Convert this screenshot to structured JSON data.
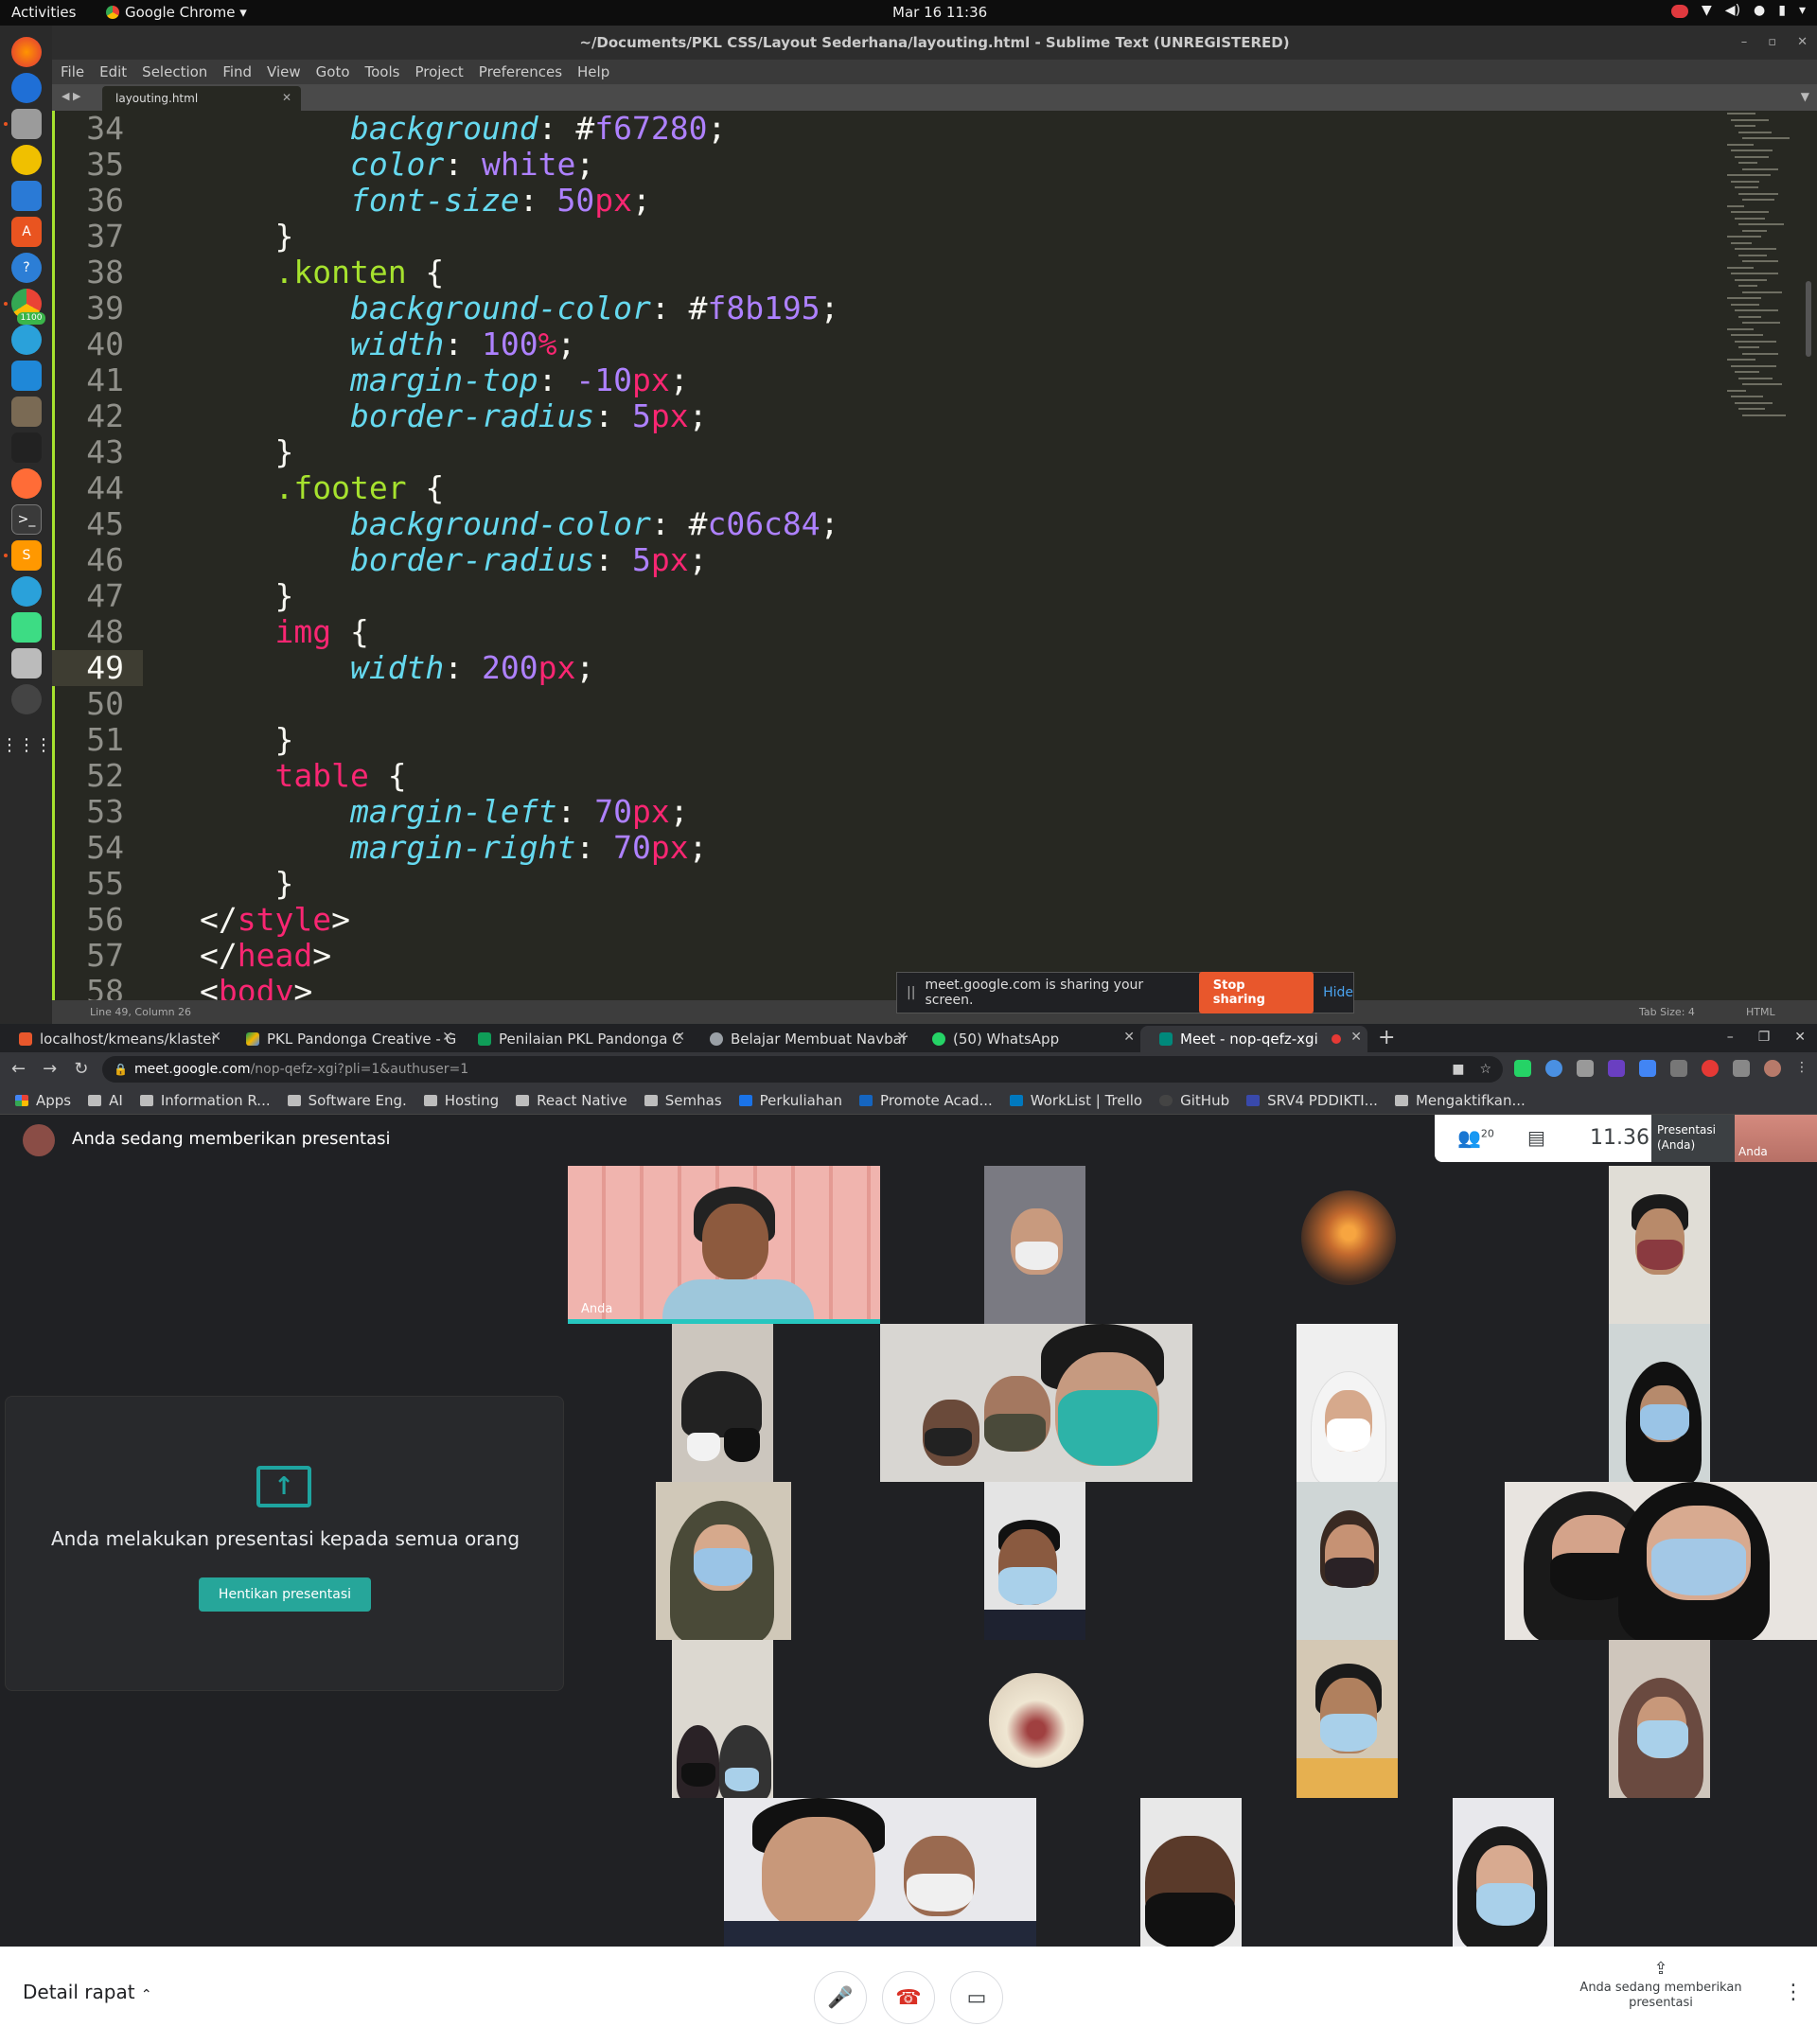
{
  "ubuntu": {
    "activities": "Activities",
    "app_menu": "Google Chrome ▾",
    "clock": "Mar 16  11:36"
  },
  "sublime": {
    "title": "~/Documents/PKL CSS/Layout Sederhana/layouting.html - Sublime Text (UNREGISTERED)",
    "menu": [
      "File",
      "Edit",
      "Selection",
      "Find",
      "View",
      "Goto",
      "Tools",
      "Project",
      "Preferences",
      "Help"
    ],
    "tab": "layouting.html",
    "status_position": "Line 49, Column 26",
    "tab_size": "Tab Size: 4",
    "syntax": "HTML",
    "current_line": 49,
    "lines": [
      {
        "n": "34",
        "parts": [
          [
            "pl",
            "        "
          ],
          [
            "prop",
            "background"
          ],
          [
            "pl",
            ": #"
          ],
          [
            "num",
            "f67280"
          ],
          [
            "pl",
            ";"
          ]
        ]
      },
      {
        "n": "35",
        "parts": [
          [
            "pl",
            "        "
          ],
          [
            "prop",
            "color"
          ],
          [
            "pl",
            ": "
          ],
          [
            "num",
            "white"
          ],
          [
            "pl",
            ";"
          ]
        ]
      },
      {
        "n": "36",
        "parts": [
          [
            "pl",
            "        "
          ],
          [
            "prop",
            "font-size"
          ],
          [
            "pl",
            ": "
          ],
          [
            "num",
            "50"
          ],
          [
            "unit",
            "px"
          ],
          [
            "pl",
            ";"
          ]
        ]
      },
      {
        "n": "37",
        "parts": [
          [
            "pl",
            "    }"
          ]
        ]
      },
      {
        "n": "38",
        "parts": [
          [
            "pl",
            "    "
          ],
          [
            "sel",
            ".konten"
          ],
          [
            "pl",
            " {"
          ]
        ]
      },
      {
        "n": "39",
        "parts": [
          [
            "pl",
            "        "
          ],
          [
            "prop",
            "background-color"
          ],
          [
            "pl",
            ": #"
          ],
          [
            "num",
            "f8b195"
          ],
          [
            "pl",
            ";"
          ]
        ]
      },
      {
        "n": "40",
        "parts": [
          [
            "pl",
            "        "
          ],
          [
            "prop",
            "width"
          ],
          [
            "pl",
            ": "
          ],
          [
            "num",
            "100"
          ],
          [
            "unit",
            "%"
          ],
          [
            "pl",
            ";"
          ]
        ]
      },
      {
        "n": "41",
        "parts": [
          [
            "pl",
            "        "
          ],
          [
            "prop",
            "margin-top"
          ],
          [
            "pl",
            ": "
          ],
          [
            "num",
            "-10"
          ],
          [
            "unit",
            "px"
          ],
          [
            "pl",
            ";"
          ]
        ]
      },
      {
        "n": "42",
        "parts": [
          [
            "pl",
            "        "
          ],
          [
            "prop",
            "border-radius"
          ],
          [
            "pl",
            ": "
          ],
          [
            "num",
            "5"
          ],
          [
            "unit",
            "px"
          ],
          [
            "pl",
            ";"
          ]
        ]
      },
      {
        "n": "43",
        "parts": [
          [
            "pl",
            "    }"
          ]
        ]
      },
      {
        "n": "44",
        "parts": [
          [
            "pl",
            "    "
          ],
          [
            "sel",
            ".footer"
          ],
          [
            "pl",
            " {"
          ]
        ]
      },
      {
        "n": "45",
        "parts": [
          [
            "pl",
            "        "
          ],
          [
            "prop",
            "background-color"
          ],
          [
            "pl",
            ": #"
          ],
          [
            "num",
            "c06c84"
          ],
          [
            "pl",
            ";"
          ]
        ]
      },
      {
        "n": "46",
        "parts": [
          [
            "pl",
            "        "
          ],
          [
            "prop",
            "border-radius"
          ],
          [
            "pl",
            ": "
          ],
          [
            "num",
            "5"
          ],
          [
            "unit",
            "px"
          ],
          [
            "pl",
            ";"
          ]
        ]
      },
      {
        "n": "47",
        "parts": [
          [
            "pl",
            "    }"
          ]
        ]
      },
      {
        "n": "48",
        "parts": [
          [
            "pl",
            "    "
          ],
          [
            "tag",
            "img"
          ],
          [
            "pl",
            " {"
          ]
        ]
      },
      {
        "n": "49",
        "parts": [
          [
            "pl",
            "        "
          ],
          [
            "prop",
            "width"
          ],
          [
            "pl",
            ": "
          ],
          [
            "num",
            "200"
          ],
          [
            "unit",
            "px"
          ],
          [
            "pl",
            ";"
          ]
        ]
      },
      {
        "n": "50",
        "parts": [
          [
            "pl",
            ""
          ]
        ]
      },
      {
        "n": "51",
        "parts": [
          [
            "pl",
            "    }"
          ]
        ]
      },
      {
        "n": "52",
        "parts": [
          [
            "pl",
            "    "
          ],
          [
            "tag",
            "table"
          ],
          [
            "pl",
            " {"
          ]
        ]
      },
      {
        "n": "53",
        "parts": [
          [
            "pl",
            "        "
          ],
          [
            "prop",
            "margin-left"
          ],
          [
            "pl",
            ": "
          ],
          [
            "num",
            "70"
          ],
          [
            "unit",
            "px"
          ],
          [
            "pl",
            ";"
          ]
        ]
      },
      {
        "n": "54",
        "parts": [
          [
            "pl",
            "        "
          ],
          [
            "prop",
            "margin-right"
          ],
          [
            "pl",
            ": "
          ],
          [
            "num",
            "70"
          ],
          [
            "unit",
            "px"
          ],
          [
            "pl",
            ";"
          ]
        ]
      },
      {
        "n": "55",
        "parts": [
          [
            "pl",
            "    }"
          ]
        ]
      },
      {
        "n": "56",
        "parts": [
          [
            "pl",
            "</"
          ],
          [
            "tag",
            "style"
          ],
          [
            "pl",
            ">"
          ]
        ]
      },
      {
        "n": "57",
        "parts": [
          [
            "pl",
            "</"
          ],
          [
            "tag",
            "head"
          ],
          [
            "pl",
            ">"
          ]
        ]
      },
      {
        "n": "58",
        "parts": [
          [
            "pl",
            "<"
          ],
          [
            "tag",
            "body"
          ],
          [
            "pl",
            ">"
          ]
        ]
      }
    ]
  },
  "sharebar": {
    "message": "meet.google.com is sharing your screen.",
    "stop_label": "Stop sharing",
    "hide_label": "Hide"
  },
  "chrome": {
    "tabs": [
      {
        "title": "localhost/kmeans/klaster",
        "color": "#e8572c"
      },
      {
        "title": "PKL Pandonga Creative - G",
        "color": "#f4b400"
      },
      {
        "title": "Penilaian PKL Pandonga C",
        "color": "#0f9d58"
      },
      {
        "title": "Belajar Membuat Navbar",
        "color": "#9aa0a6"
      },
      {
        "title": "(50) WhatsApp",
        "color": "#25d366"
      },
      {
        "title": "Meet - nop-qefz-xgi",
        "color": "#00897b"
      }
    ],
    "url_host": "meet.google.com",
    "url_path": "/nop-qefz-xgi?pli=1&authuser=1",
    "bookmarks": [
      {
        "label": "Apps",
        "color": "#ea4335"
      },
      {
        "label": "AI",
        "color": "#bdbdbd"
      },
      {
        "label": "Information R...",
        "color": "#bdbdbd"
      },
      {
        "label": "Software Eng.",
        "color": "#bdbdbd"
      },
      {
        "label": "Hosting",
        "color": "#bdbdbd"
      },
      {
        "label": "React Native",
        "color": "#bdbdbd"
      },
      {
        "label": "Semhas",
        "color": "#bdbdbd"
      },
      {
        "label": "Perkuliahan",
        "color": "#1a73e8"
      },
      {
        "label": "Promote Acad...",
        "color": "#1565c0"
      },
      {
        "label": "WorkList | Trello",
        "color": "#0079bf"
      },
      {
        "label": "GitHub",
        "color": "#444444"
      },
      {
        "label": "SRV4 PDDIKTI...",
        "color": "#3949ab"
      },
      {
        "label": "Mengaktifkan...",
        "color": "#bdbdbd"
      }
    ]
  },
  "meet": {
    "header_title": "Anda sedang memberikan presentasi",
    "participants_count": "20",
    "time": "11.36",
    "pip_label": "Presentasi (Anda)",
    "pip_name": "Anda",
    "presenting_message": "Anda melakukan presentasi kepada semua orang",
    "stop_presenting_label": "Hentikan presentasi",
    "self_label": "Anda",
    "details_label": "Detail rapat",
    "bottom_presenting": "Anda sedang memberikan presentasi",
    "colors": {
      "accent": "#26a69a",
      "end_call": "#d93025"
    }
  }
}
